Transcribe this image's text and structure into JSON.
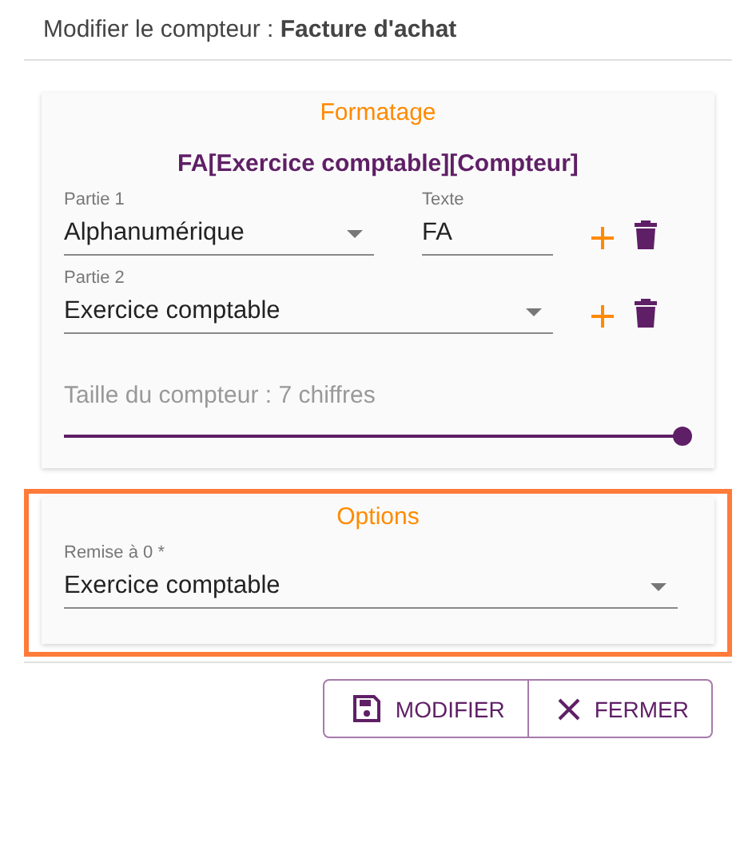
{
  "title": "Modifier le compteur : **Facture d'achat**",
  "formatting": {
    "heading": "Formatage",
    "pattern": "FA[Exercice comptable][Compteur]",
    "parts": [
      {
        "kind": "select-with-text",
        "label": "Partie 1",
        "value": "Alphanumérique",
        "text_label": "Texte",
        "text_value": "FA"
      },
      {
        "kind": "select",
        "label": "Partie 2",
        "value": "Exercice comptable"
      }
    ],
    "size_label": "Taille du compteur : 7 chiffres",
    "level": 1
  },
  "options": {
    "heading": "Options",
    "highlighted": true,
    "reset_label": "Remise à 0 *",
    "reset_value": "Exercice comptable"
  },
  "buttons": [
    {
      "kind": "save",
      "label": "MODIFIER"
    },
    {
      "kind": "close",
      "label": "FERMER"
    }
  ]
}
